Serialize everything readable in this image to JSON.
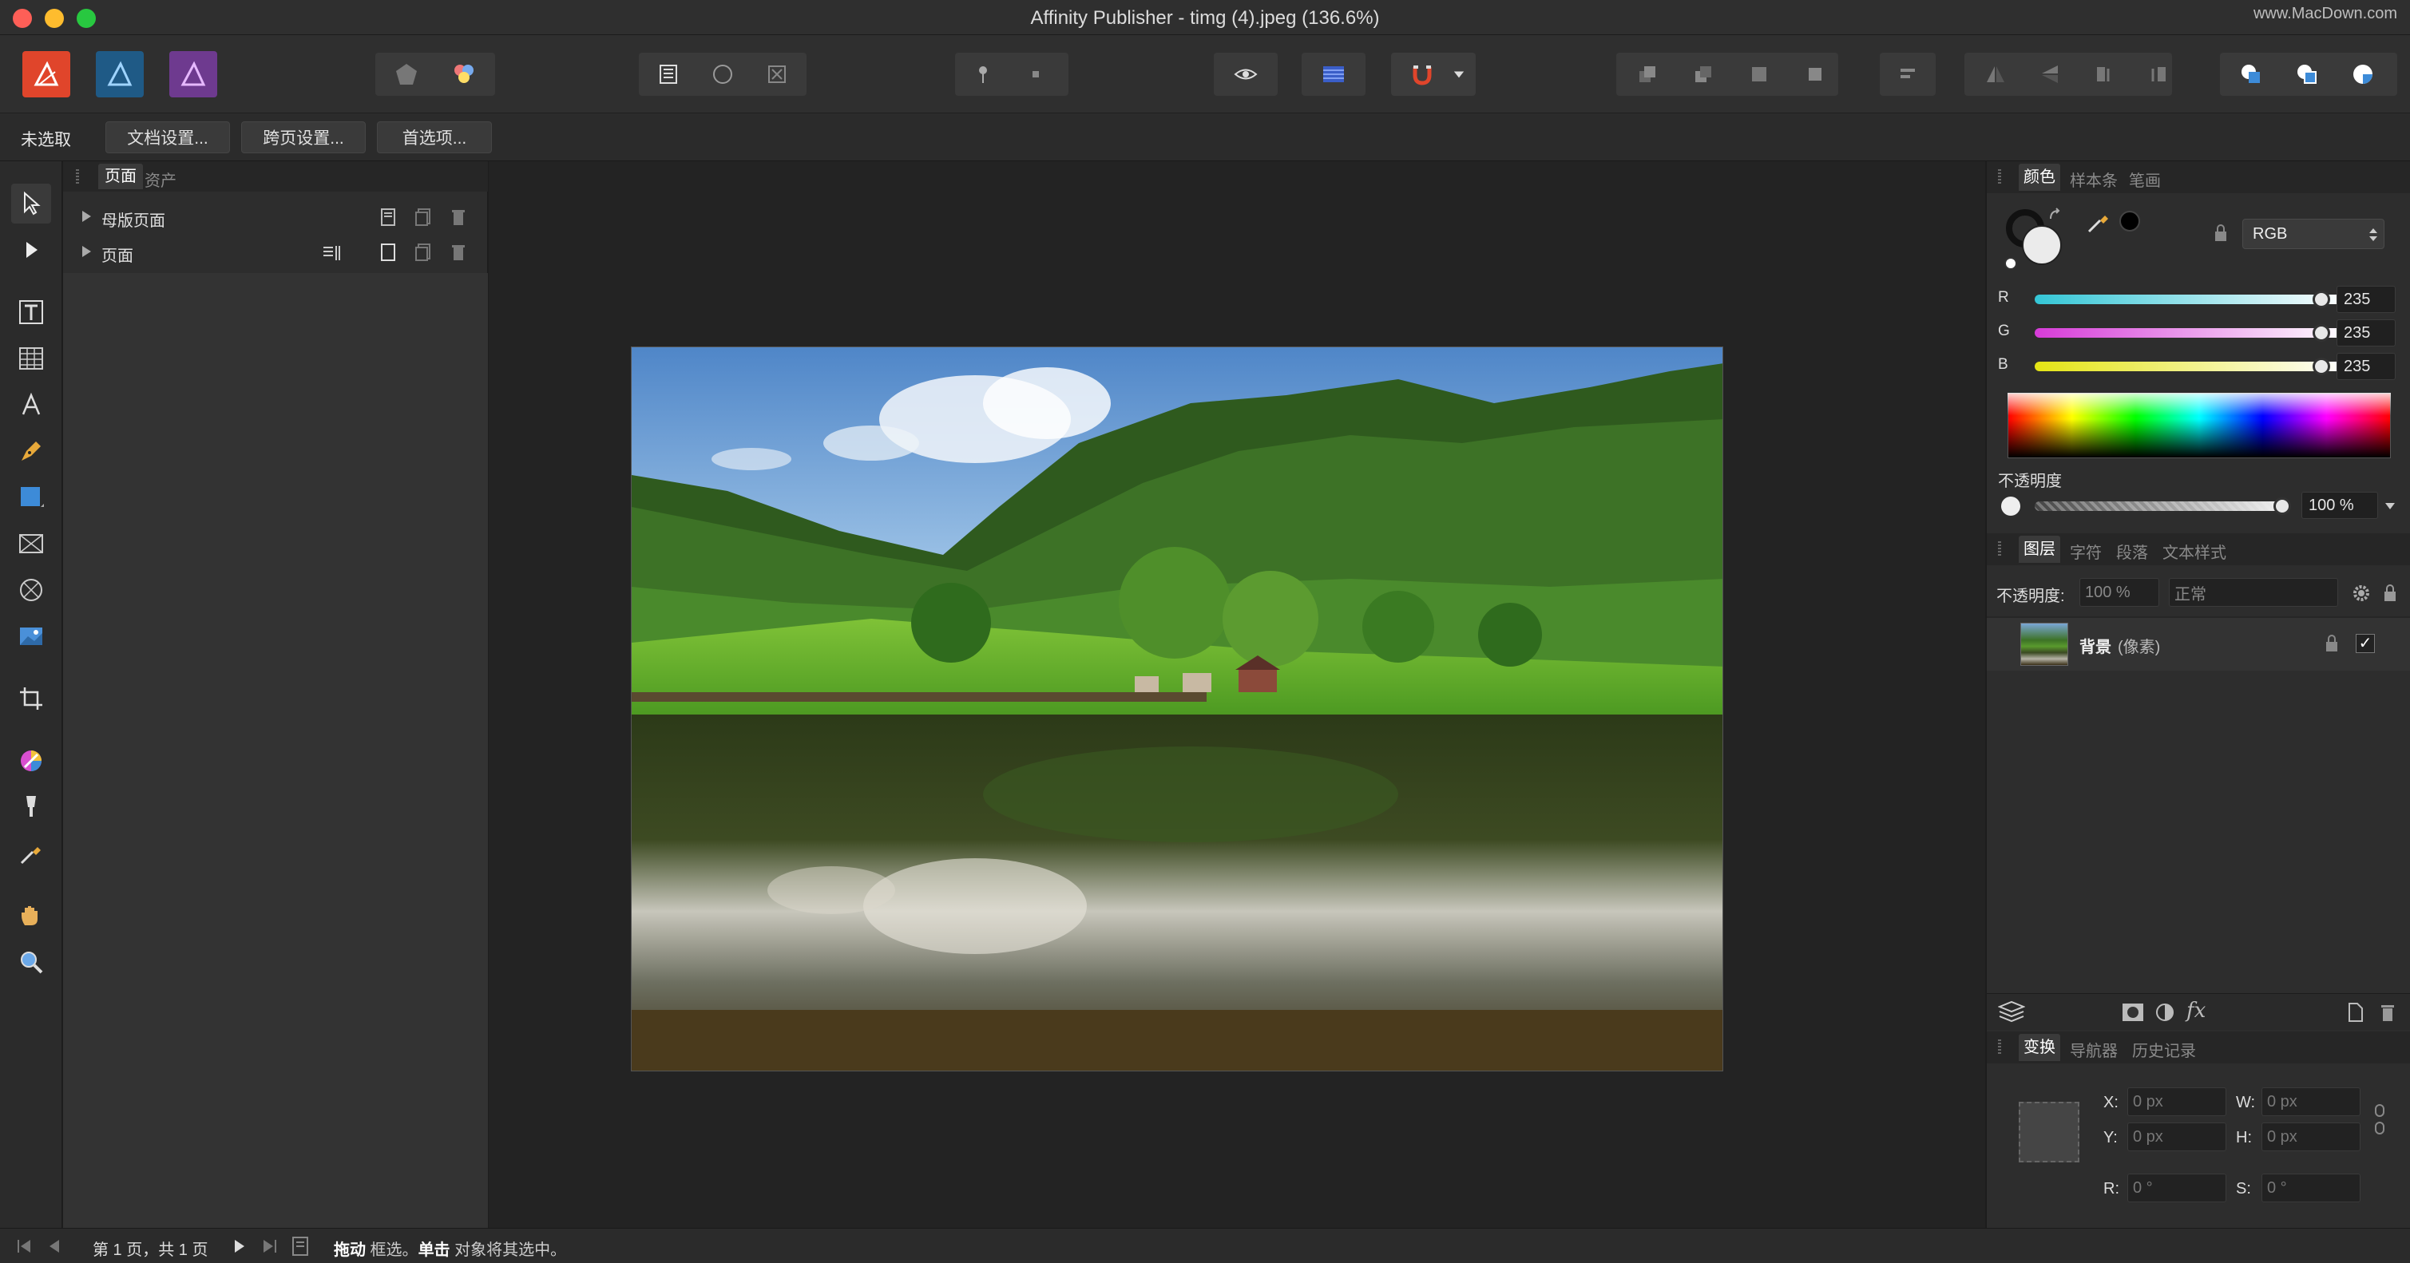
{
  "window": {
    "title": "Affinity Publisher - timg (4).jpeg (136.6%)",
    "watermark": "www.MacDown.com"
  },
  "context_bar": {
    "status_label": "未选取",
    "doc_settings": "文档设置...",
    "spread_settings": "跨页设置...",
    "preferences": "首选项..."
  },
  "pages_panel": {
    "tabs": [
      "页面",
      "资产"
    ],
    "rows": [
      {
        "label": "母版页面"
      },
      {
        "label": "页面"
      }
    ]
  },
  "color_panel": {
    "tabs": [
      "颜色",
      "样本条",
      "笔画"
    ],
    "mode": "RGB",
    "channels": [
      {
        "label": "R",
        "value": "235",
        "fraction": 0.92,
        "color_from": "#34c6d6",
        "color_to": "#ffffff"
      },
      {
        "label": "G",
        "value": "235",
        "fraction": 0.92,
        "color_from": "#d63bd8",
        "color_to": "#ffffff"
      },
      {
        "label": "B",
        "value": "235",
        "fraction": 0.92,
        "color_from": "#e4e414",
        "color_to": "#ffffff"
      }
    ],
    "opacity_label": "不透明度",
    "opacity_value": "100 %",
    "opacity_fraction": 1.0
  },
  "layers_panel": {
    "tabs": [
      "图层",
      "字符",
      "段落",
      "文本样式"
    ],
    "opacity_label": "不透明度:",
    "opacity_value": "100 %",
    "blend_mode": "正常",
    "layers": [
      {
        "name": "背景",
        "type": "(像素)",
        "visible": true
      }
    ]
  },
  "transform_panel": {
    "tabs": [
      "变换",
      "导航器",
      "历史记录"
    ],
    "x_label": "X:",
    "x_value": "0 px",
    "y_label": "Y:",
    "y_value": "0 px",
    "w_label": "W:",
    "w_value": "0 px",
    "h_label": "H:",
    "h_value": "0 px",
    "r_label": "R:",
    "r_value": "0 °",
    "s_label": "S:",
    "s_value": "0 °"
  },
  "status_bar": {
    "page_info": "第 1 页，共 1 页",
    "hint_bold1": "拖动",
    "hint_text1": " 框选。",
    "hint_bold2": "单击",
    "hint_text2": " 对象将其选中。"
  },
  "colors": {
    "accent_red": "#e0452b",
    "traffic_close": "#fe5f57",
    "traffic_min": "#febc2e",
    "traffic_max": "#28c840"
  }
}
